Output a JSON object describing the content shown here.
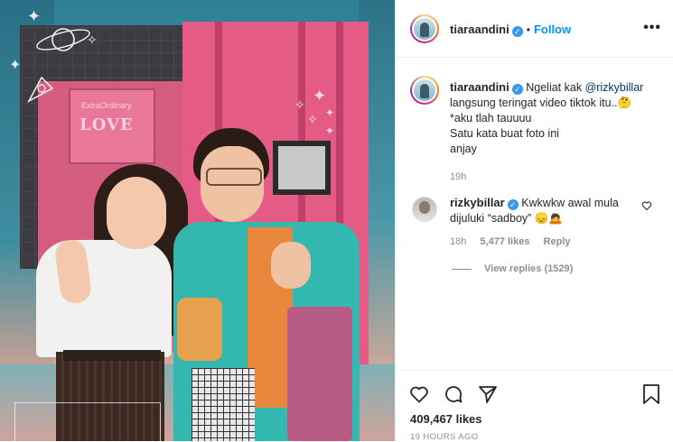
{
  "post": {
    "username": "tiaraandini",
    "verified_mark": "✓",
    "separator": "•",
    "follow_label": "Follow",
    "more_label": "•••",
    "photo_sign_small": "ExtraOrdinary",
    "photo_sign_big": "LOVE"
  },
  "caption": {
    "username": "tiaraandini",
    "text_before": "Ngeliat kak ",
    "mention": "@rizkybillar",
    "line1_after": " langsung teringat video tiktok itu..🤔",
    "line2": "*aku tlah tauuuu",
    "line3": "Satu kata buat foto ini",
    "line4": "anjay",
    "time": "19h"
  },
  "comment": {
    "username": "rizkybillar",
    "text": "Kwkwkw awal mula dijuluki “sadboy” 😞🙇",
    "time": "18h",
    "likes": "5,477 likes",
    "reply_label": "Reply",
    "view_replies": "View replies (1529)"
  },
  "footer": {
    "likes_count": "409,467 likes",
    "time_ago": "19 HOURS AGO"
  },
  "icons": [
    "heart-icon",
    "comment-icon",
    "share-icon",
    "bookmark-icon",
    "more-icon",
    "verified-icon"
  ],
  "colors": {
    "link_blue": "#0095f6",
    "mention_blue": "#00376b",
    "muted_gray": "#8e8e8e",
    "verified_blue": "#3897f0"
  }
}
